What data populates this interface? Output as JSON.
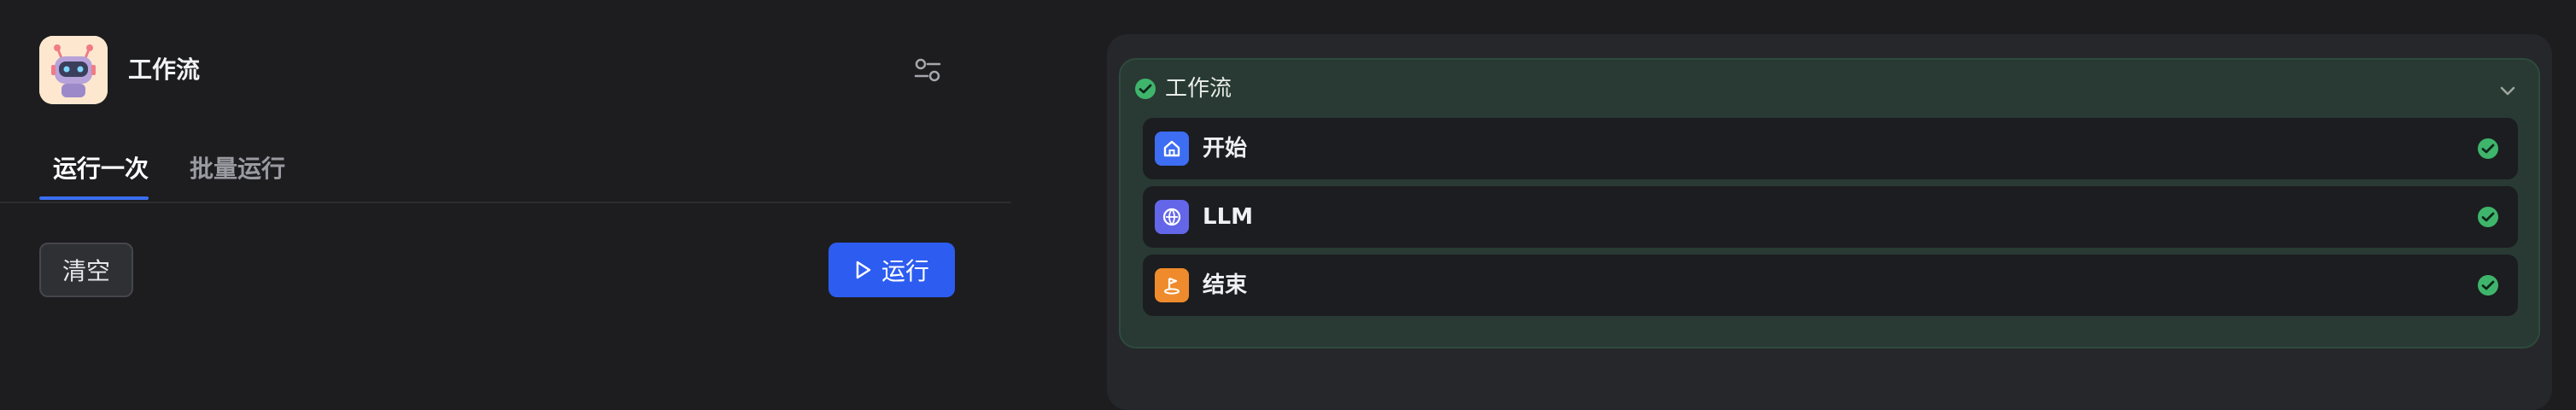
{
  "app": {
    "title": "工作流"
  },
  "tabs": [
    {
      "label": "运行一次",
      "active": true
    },
    {
      "label": "批量运行",
      "active": false
    }
  ],
  "actions": {
    "clear_label": "清空",
    "run_label": "运行"
  },
  "workflow": {
    "title": "工作流",
    "status": "success",
    "nodes": [
      {
        "label": "开始",
        "icon": "home-icon",
        "color": "#3d6df2",
        "status": "success"
      },
      {
        "label": "LLM",
        "icon": "llm-icon",
        "color": "#6366e8",
        "status": "success"
      },
      {
        "label": "结束",
        "icon": "end-flag-icon",
        "color": "#ef8b2c",
        "status": "success"
      }
    ]
  },
  "colors": {
    "accent": "#2d5cf0",
    "success": "#3fb56c",
    "tab_indicator": "#3b6ef0"
  }
}
